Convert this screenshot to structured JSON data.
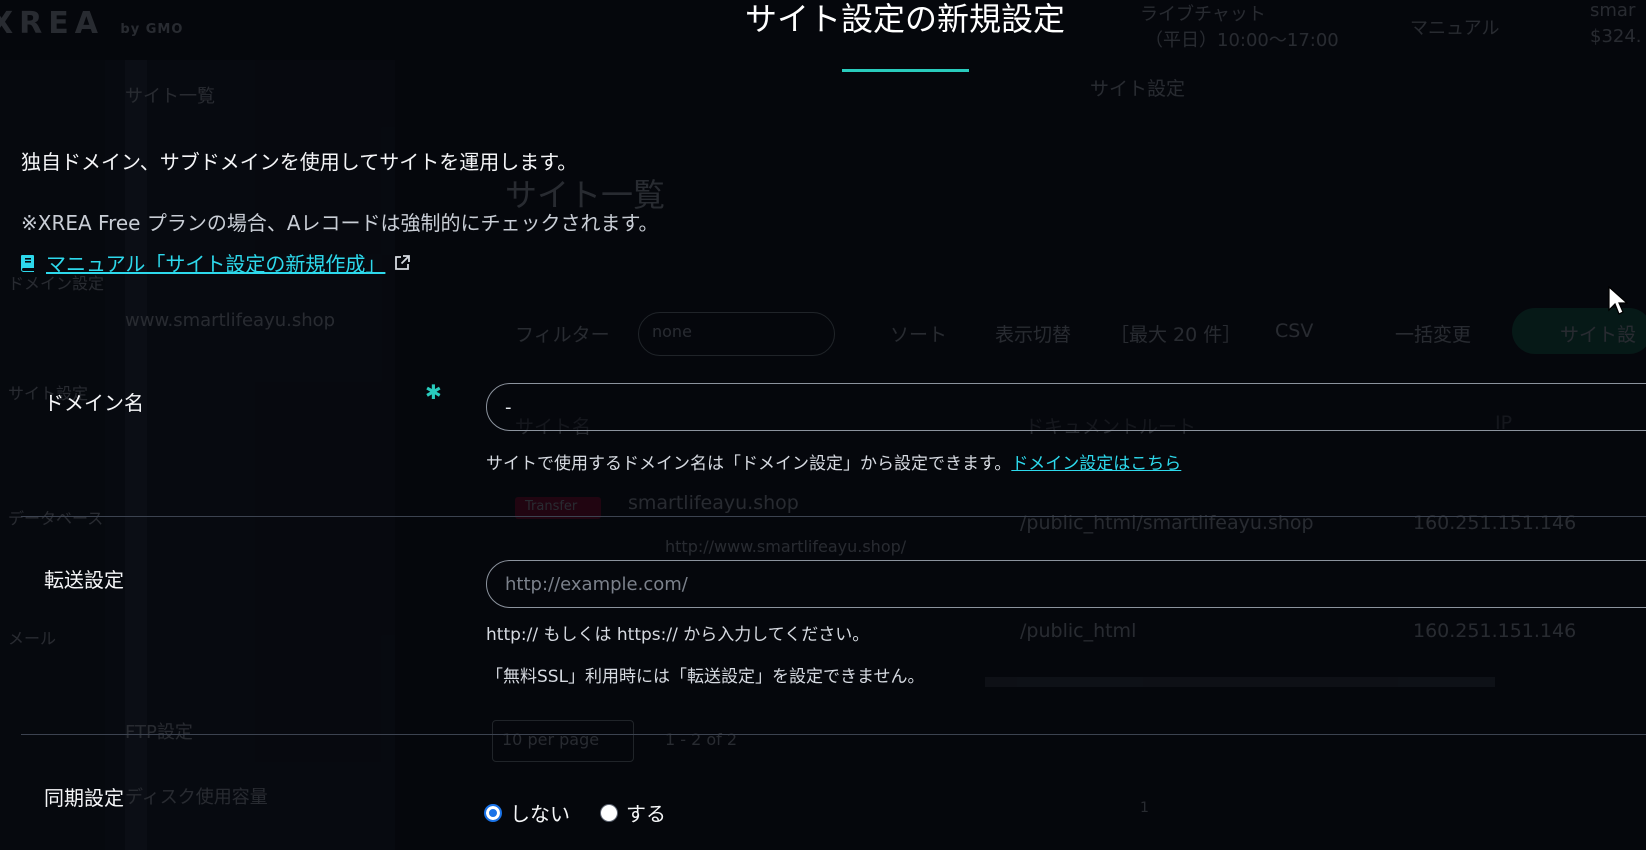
{
  "background": {
    "logo": "XREA",
    "logo_sub": "by GMO",
    "rail": [
      "ドメイン設定",
      "サイト設定",
      "データベース",
      "メール"
    ],
    "submenu": [
      "サイト一覧",
      "www.smartlifeayu.shop",
      "FTP設定",
      "ディスク使用容量"
    ],
    "top": [
      "ライブチャット",
      "（平日）10:00～17:00",
      "マニュアル",
      "smar",
      "$324."
    ],
    "breadcrumb": "サイト設定",
    "heading": "サイト一覧",
    "toolbar": [
      "フィルター",
      "none",
      "ソート",
      "表示切替",
      "［最大 20 件］",
      "CSV",
      "一括変更",
      "サイト設"
    ],
    "columns": [
      "サイト名",
      "ドキュメントルート",
      "IP"
    ],
    "rows": [
      {
        "name": "smartlifeayu.shop",
        "badge": "Transfer",
        "redirect": "http://www.smartlifeayu.shop/",
        "root": "/public_html/smartlifeayu.shop",
        "ip": "160.251.151.146"
      },
      {
        "name": "",
        "root": "/public_html",
        "ip": "160.251.151.146"
      }
    ],
    "pager": [
      "10 per page",
      "1 - 2 of 2",
      "1"
    ]
  },
  "modal": {
    "title": "サイト設定の新規設定",
    "description": "独自ドメイン、サブドメインを使用してサイトを運用します。",
    "note": "※XREA Free プランの場合、Aレコードは強制的にチェックされます。",
    "manual_link": "マニュアル「サイト設定の新規作成」",
    "domain": {
      "label": "ドメイン名",
      "required_mark": "✱",
      "value": "-",
      "help": "サイトで使用するドメイン名は「ドメイン設定」から設定できます。",
      "help_link": "ドメイン設定はこちら"
    },
    "forward": {
      "label": "転送設定",
      "value": "",
      "placeholder": "http://example.com/",
      "help1": "http:// もしくは https:// から入力してください。",
      "help2": "「無料SSL」利用時には「転送設定」を設定できません。"
    },
    "sync": {
      "label": "同期設定",
      "options": [
        "しない",
        "する"
      ],
      "selected": "しない"
    }
  },
  "colors": {
    "accent": "#29cbbd",
    "link": "#2dd9ec",
    "background": "#05070c"
  }
}
